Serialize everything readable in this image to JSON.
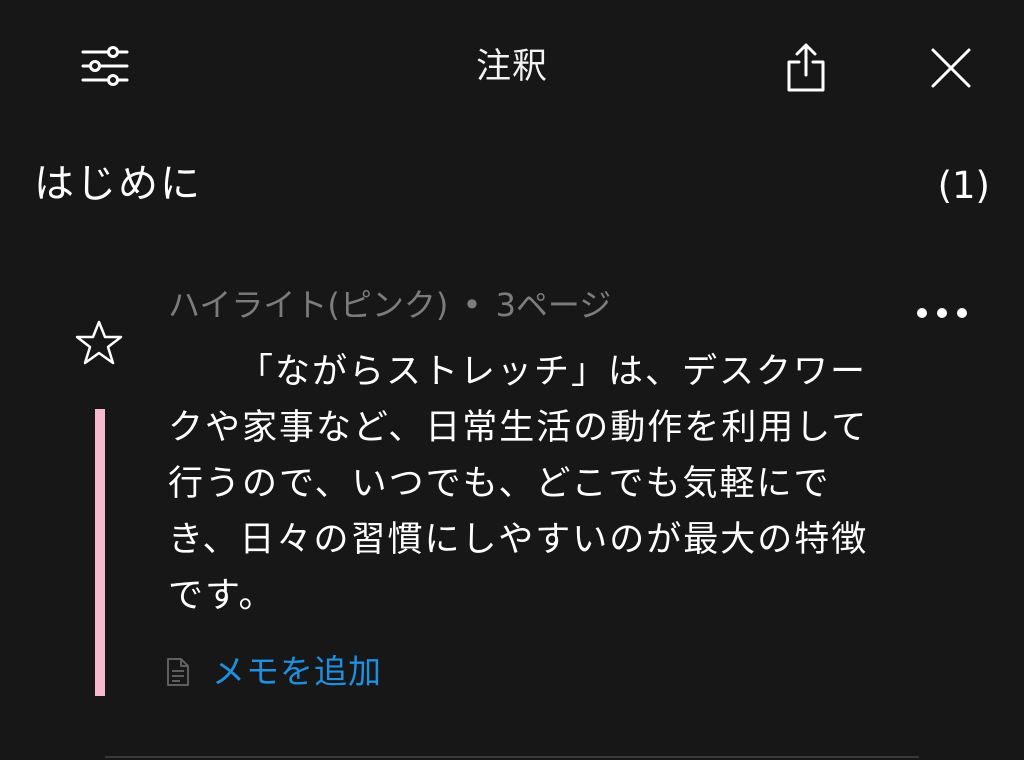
{
  "header": {
    "title": "注釈",
    "filter_icon": "sliders-icon",
    "share_icon": "share-icon",
    "close_icon": "close-icon"
  },
  "section": {
    "title": "はじめに",
    "count": "(1)"
  },
  "annotation": {
    "type_label": "ハイライト(ピンク)",
    "separator": "•",
    "page_label": "3ページ",
    "text": "「ながらストレッチ」は、デスクワークや家事など、日常生活の動作を利用して行うので、いつでも、どこでも気軽にでき、日々の習慣にしやすいのが最大の特徴です。",
    "highlight_color": "#f7b9ce",
    "star_icon": "star-outline-icon",
    "more_icon": "more-horizontal-icon",
    "add_memo_label": "メモを追加",
    "memo_icon": "note-icon",
    "accent_color": "#1f8fe0"
  }
}
